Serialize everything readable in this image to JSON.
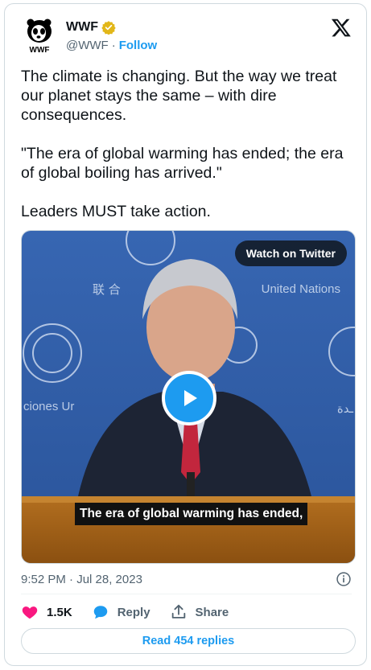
{
  "author": {
    "name": "WWF",
    "handle": "@WWF",
    "separator": "·",
    "follow_label": "Follow",
    "logo_text": "WWF"
  },
  "tweet": {
    "text": "The climate is changing. But the way we treat our planet stays the same – with dire consequences.\n\n \"The era of global warming has ended; the era of global boiling has arrived.\"\n\nLeaders MUST take action."
  },
  "media": {
    "watch_label": "Watch on Twitter",
    "subtitle": "The era of global warming has ended,",
    "background_text_right": "United Nations",
    "background_text_left": "ciones Ur",
    "background_text_cjk": "联 合",
    "background_text_arabic": "ـدة"
  },
  "meta": {
    "timestamp": "9:52 PM · Jul 28, 2023"
  },
  "actions": {
    "likes": "1.5K",
    "reply_label": "Reply",
    "share_label": "Share",
    "read_replies": "Read 454 replies"
  },
  "colors": {
    "accent": "#1d9bf0",
    "like": "#f91880",
    "verified_gold": "#e2b719",
    "un_blue": "#2f5fa8"
  }
}
